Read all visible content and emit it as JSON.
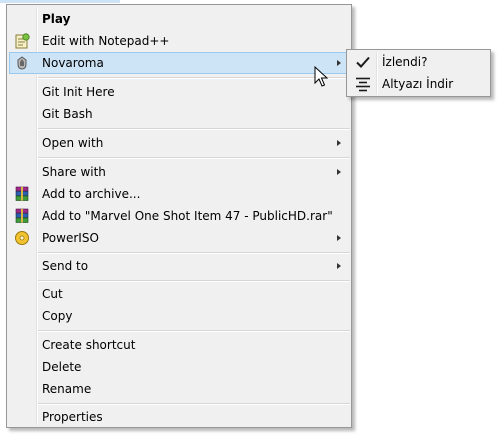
{
  "menu": {
    "play": "Play",
    "edit_notepad": "Edit with Notepad++",
    "novaroma": "Novaroma",
    "git_init": "Git Init Here",
    "git_bash": "Git Bash",
    "open_with": "Open with",
    "share_with": "Share with",
    "add_archive": "Add to archive...",
    "add_to_rar": "Add to \"Marvel One Shot Item 47 - PublicHD.rar\"",
    "poweriso": "PowerISO",
    "send_to": "Send to",
    "cut": "Cut",
    "copy": "Copy",
    "create_shortcut": "Create shortcut",
    "delete": "Delete",
    "rename": "Rename",
    "properties": "Properties"
  },
  "submenu": {
    "watched": "İzlendi?",
    "subtitle_download": "Altyazı İndir"
  },
  "icons": {
    "notepad": "notepad-plus-plus-icon",
    "novaroma": "novaroma-icon",
    "winrar": "winrar-icon",
    "poweriso": "poweriso-icon",
    "check": "check-icon",
    "align": "align-center-icon"
  },
  "colors": {
    "menu_bg": "#f0f0f0",
    "hover_bg": "#cde4f7",
    "hover_border": "#99c9ef"
  }
}
